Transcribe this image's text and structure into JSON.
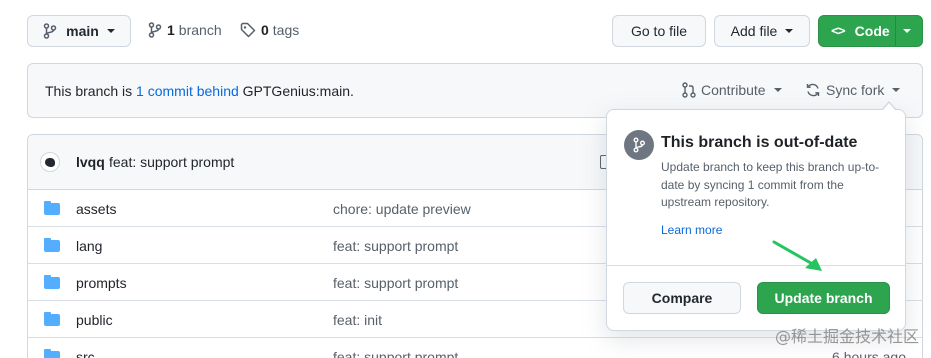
{
  "toolbar": {
    "branch_name": "main",
    "branch_count": "1",
    "branch_label": "branch",
    "tag_count": "0",
    "tag_label": "tags",
    "go_to_file": "Go to file",
    "add_file": "Add file",
    "code": "Code"
  },
  "status": {
    "prefix": "This branch is ",
    "behind_link": "1 commit behind",
    "suffix": " GPTGenius:main.",
    "contribute": "Contribute",
    "sync_fork": "Sync fork"
  },
  "latest_commit": {
    "author": "lvqq",
    "message": "feat: support prompt"
  },
  "files": [
    {
      "name": "assets",
      "commit": "chore: update preview",
      "age": ""
    },
    {
      "name": "lang",
      "commit": "feat: support prompt",
      "age": ""
    },
    {
      "name": "prompts",
      "commit": "feat: support prompt",
      "age": ""
    },
    {
      "name": "public",
      "commit": "feat: init",
      "age": ""
    },
    {
      "name": "src",
      "commit": "feat: support prompt",
      "age": "6 hours ago"
    }
  ],
  "popover": {
    "title": "This branch is out-of-date",
    "body": "Update branch to keep this branch up-to-date by syncing 1 commit from the upstream repository.",
    "learn_more": "Learn more",
    "compare": "Compare",
    "update_branch": "Update branch"
  },
  "watermark": "@稀土掘金技术社区",
  "colors": {
    "primary_green": "#2da44e",
    "link_blue": "#0969da",
    "folder_blue": "#54aeff",
    "annotation_arrow": "#22c55e"
  }
}
